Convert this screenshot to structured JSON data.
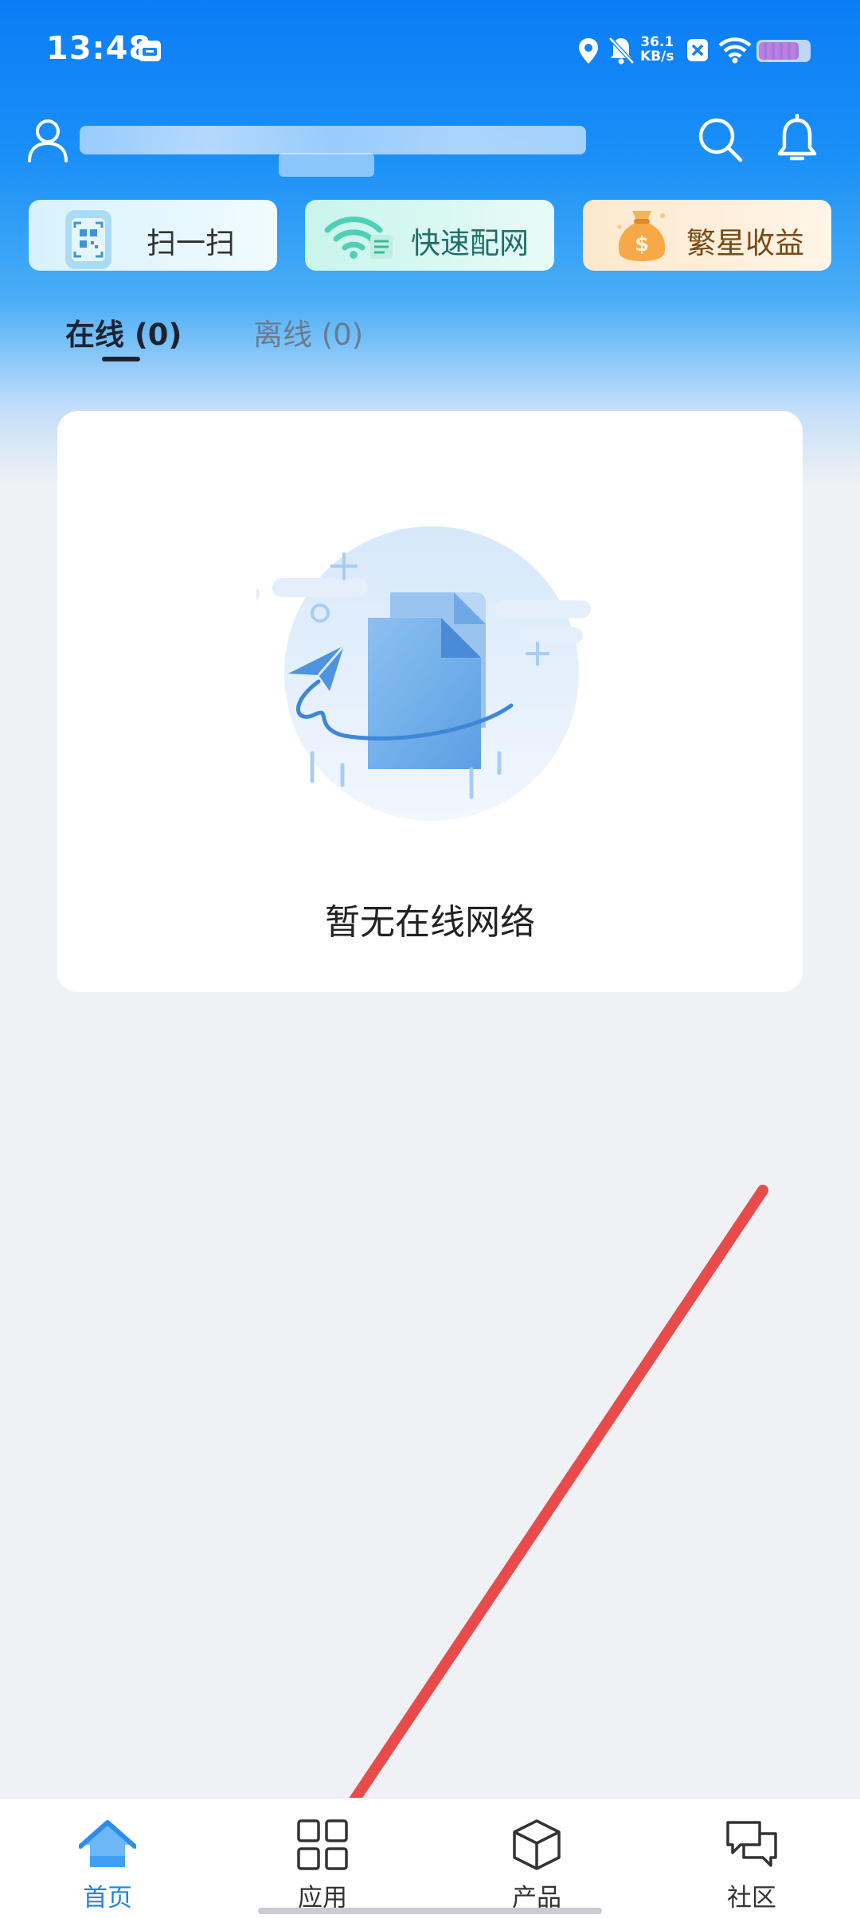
{
  "status_bar": {
    "time": "13:48",
    "net_speed_value": "36.1",
    "net_speed_unit": "KB/s",
    "battery_level": 0.8
  },
  "header": {
    "icons": [
      "user-icon",
      "search-icon",
      "bell-icon"
    ]
  },
  "quick_actions": [
    {
      "label": "扫一扫",
      "icon": "qr-scan-icon"
    },
    {
      "label": "快速配网",
      "icon": "wifi-config-icon"
    },
    {
      "label": "繁星收益",
      "icon": "money-bag-icon"
    }
  ],
  "tabs": [
    {
      "label": "在线 (0)",
      "active": true
    },
    {
      "label": "离线 (0)",
      "active": false
    }
  ],
  "empty_state": {
    "message": "暂无在线网络"
  },
  "bottom_nav": [
    {
      "label": "首页",
      "icon": "home-icon",
      "active": true
    },
    {
      "label": "应用",
      "icon": "apps-grid-icon",
      "active": false
    },
    {
      "label": "产品",
      "icon": "cube-icon",
      "active": false
    },
    {
      "label": "社区",
      "icon": "chat-bubbles-icon",
      "active": false
    }
  ],
  "colors": {
    "brand_blue": "#1a86e8",
    "annotation_red": "#e94b4b",
    "background": "#eff1f5"
  }
}
